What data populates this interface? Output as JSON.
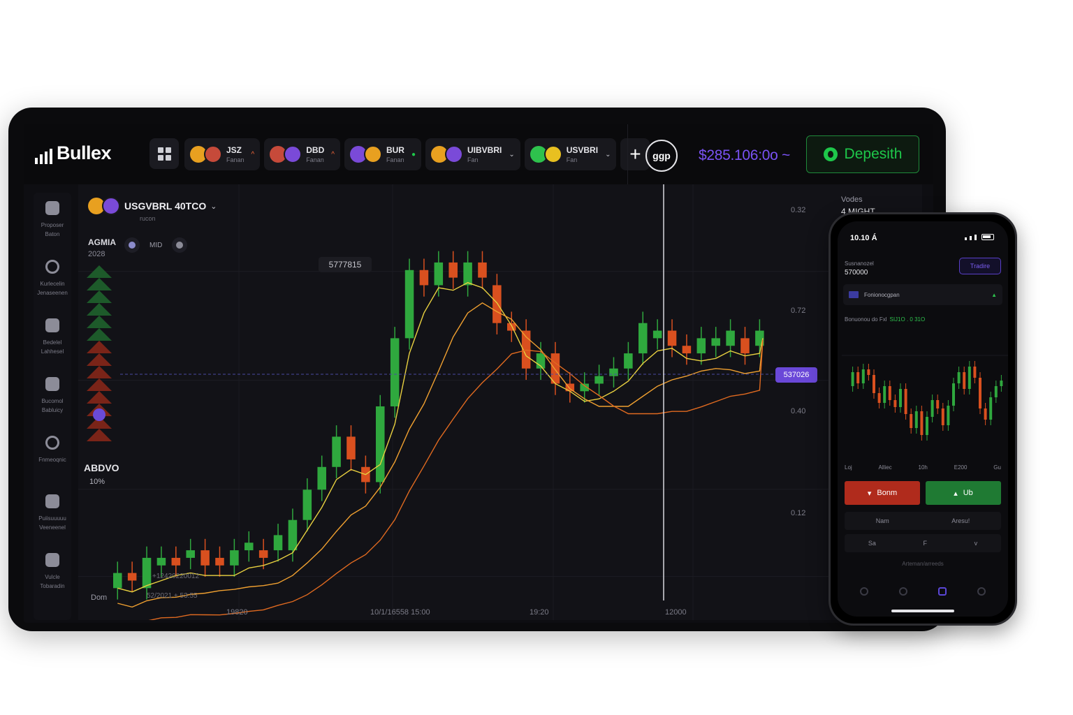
{
  "app": {
    "logo_text": "Bullex",
    "balance": "$285.106:0o ~",
    "deposit_label": "Depesith",
    "circle_label": "ggp"
  },
  "asset_tabs": [
    {
      "name": "JSZ",
      "sub": "Fanan",
      "mark": "^",
      "mark_color": "#ff6a3a"
    },
    {
      "name": "DBD",
      "sub": "Fanan",
      "mark": "^",
      "mark_color": "#ff6a3a"
    },
    {
      "name": "BUR",
      "sub": "Fanan",
      "mark": "●",
      "mark_color": "#1ec84a"
    },
    {
      "name": "UIBVBRI",
      "sub": "Fan",
      "mark": "⌄",
      "mark_color": "#c6c6ce"
    },
    {
      "name": "USVBRI",
      "sub": "Fan",
      "mark": "⌄",
      "mark_color": "#c6c6ce"
    }
  ],
  "sidebar": [
    {
      "icon": "briefcase-icon",
      "label": "Proposer Baton"
    },
    {
      "icon": "target-icon",
      "label": "Kurlecelin Jenaseenen"
    },
    {
      "icon": "coin-icon",
      "label": "Bedelel Lahhesel"
    },
    {
      "icon": "shield-icon",
      "label": "Bucomol Babluicy"
    },
    {
      "icon": "cloud-icon",
      "label": "Fnmeoqnic"
    },
    {
      "icon": "chart-icon",
      "label": "Puiisuuuuu Veeneenel"
    },
    {
      "icon": "gear-icon",
      "label": "Vulcle Tobaradin"
    }
  ],
  "chart": {
    "pair_name": "USGVBRL 40TCO",
    "pair_sub": "rucon",
    "stat_title": "AGMIA",
    "stat_value": "2028",
    "tool_label": "MID",
    "big_label": "ABDVO",
    "small_label": "10%",
    "dom_label": "Dom",
    "peak_label": "5777815",
    "price_tag": "537026",
    "vol_label": "Vodes",
    "vol_value": "4 MIGHT",
    "y_ticks": [
      "0.32",
      "0.72",
      "0.40",
      "0.12"
    ],
    "x_ticks": [
      "19820",
      "10/1/16558 15:00",
      "19:20",
      "12000"
    ],
    "bottom_note_1": "+12420220012",
    "bottom_note_2": "52/2021 + 53:55"
  },
  "chart_data": {
    "type": "candlestick",
    "candles": [
      [
        0.3,
        0.32
      ],
      [
        0.32,
        0.31
      ],
      [
        0.3,
        0.34
      ],
      [
        0.33,
        0.34
      ],
      [
        0.34,
        0.33
      ],
      [
        0.34,
        0.35
      ],
      [
        0.35,
        0.33
      ],
      [
        0.34,
        0.33
      ],
      [
        0.33,
        0.35
      ],
      [
        0.35,
        0.36
      ],
      [
        0.35,
        0.34
      ],
      [
        0.35,
        0.37
      ],
      [
        0.35,
        0.39
      ],
      [
        0.39,
        0.43
      ],
      [
        0.43,
        0.46
      ],
      [
        0.46,
        0.5
      ],
      [
        0.5,
        0.47
      ],
      [
        0.46,
        0.44
      ],
      [
        0.44,
        0.54
      ],
      [
        0.54,
        0.63
      ],
      [
        0.63,
        0.72
      ],
      [
        0.72,
        0.7
      ],
      [
        0.7,
        0.73
      ],
      [
        0.73,
        0.71
      ],
      [
        0.7,
        0.73
      ],
      [
        0.73,
        0.71
      ],
      [
        0.7,
        0.65
      ],
      [
        0.65,
        0.64
      ],
      [
        0.64,
        0.59
      ],
      [
        0.59,
        0.61
      ],
      [
        0.61,
        0.57
      ],
      [
        0.57,
        0.56
      ],
      [
        0.56,
        0.57
      ],
      [
        0.57,
        0.58
      ],
      [
        0.58,
        0.59
      ],
      [
        0.59,
        0.61
      ],
      [
        0.61,
        0.65
      ],
      [
        0.63,
        0.64
      ],
      [
        0.64,
        0.62
      ],
      [
        0.62,
        0.61
      ],
      [
        0.61,
        0.63
      ],
      [
        0.62,
        0.63
      ],
      [
        0.62,
        0.64
      ],
      [
        0.63,
        0.61
      ],
      [
        0.62,
        0.64
      ]
    ],
    "ylim": [
      0.28,
      0.8
    ]
  },
  "phone": {
    "time": "10.10 Á",
    "account_label": "Susnanozel",
    "account_value": "570000",
    "trade_btn": "Tradire",
    "asset_name": "Fonionocgpan",
    "info_label": "Bonuonou do Fxl",
    "info_value": "SIJ1O . 0 31O",
    "times": [
      "Loj",
      "Alliec",
      "10h",
      "E200",
      "Gu"
    ],
    "down_label": "Bonm",
    "up_label": "Ub",
    "row1": [
      "Nam",
      "Aresu!"
    ],
    "row2": [
      "Sa",
      "F",
      "v"
    ],
    "foot": "Arteman/arreeds"
  }
}
